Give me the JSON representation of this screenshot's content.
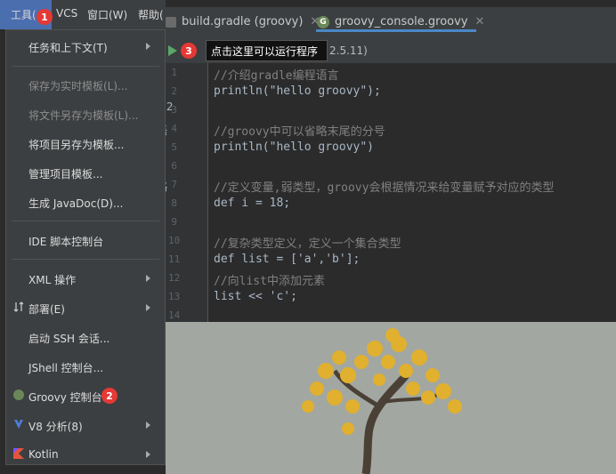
{
  "menubar": {
    "items": [
      {
        "label": "工具(",
        "selected": true
      },
      {
        "label": "VCS"
      },
      {
        "label": "窗口(W)"
      },
      {
        "label": "帮助("
      }
    ]
  },
  "tabs": [
    {
      "label": "build.gradle (groovy)",
      "icon": "gradle-icon"
    },
    {
      "label": "groovy_console.groovy",
      "icon": "groovy-icon",
      "active": true
    }
  ],
  "toolbar": {
    "tooltip": "点击这里可以运行程序",
    "version": "2.5.11)"
  },
  "editor": {
    "line_numbers": [
      "1",
      "2",
      "3",
      "4",
      "5",
      "6",
      "7",
      "8",
      "9",
      "10",
      "11",
      "12",
      "13",
      "14"
    ],
    "lines": [
      "//介绍gradle编程语言",
      "println(\"hello groovy\");",
      "",
      "//groovy中可以省略末尾的分号",
      "println(\"hello groovy\")",
      "",
      "//定义变量,弱类型，groovy会根据情况来给变量赋予对应的类型",
      "def i = 18;",
      "",
      "//复杂类型定义，定义一个集合类型",
      "def list = ['a','b'];",
      "//向list中添加元素",
      "list << 'c';"
    ]
  },
  "peek": [
    "g",
    "y 2",
    "语",
    "g",
    "略",
    "g",
    "，",
    "义",
    "，",
    "素"
  ],
  "dropdown": {
    "items": [
      {
        "label": "任务和上下文(T)",
        "submenu": true,
        "enabled": true
      },
      {
        "label": "保存为实时模板(L)...",
        "enabled": false
      },
      {
        "label": "将文件另存为模板(L)...",
        "enabled": false
      },
      {
        "label": "将项目另存为模板...",
        "enabled": true
      },
      {
        "label": "管理项目模板...",
        "enabled": true
      },
      {
        "label": "生成 JavaDoc(D)...",
        "enabled": true
      },
      {
        "label": "IDE 脚本控制台",
        "enabled": true
      },
      {
        "label": "XML 操作",
        "submenu": true,
        "enabled": true
      },
      {
        "label": "部署(E)",
        "submenu": true,
        "enabled": true,
        "icon": "deploy-icon"
      },
      {
        "label": "启动 SSH 会话...",
        "enabled": true
      },
      {
        "label": "JShell 控制台...",
        "enabled": true
      },
      {
        "label": "Groovy 控制台...",
        "enabled": true,
        "icon": "groovy-icon"
      },
      {
        "label": "V8 分析(8)",
        "submenu": true,
        "enabled": true,
        "icon": "v8-icon"
      },
      {
        "label": "Kotlin",
        "submenu": true,
        "enabled": true,
        "icon": "kotlin-icon"
      }
    ]
  },
  "badges": [
    "1",
    "2",
    "3"
  ],
  "colors": {
    "accent": "#4a88c7",
    "badge": "#e53935",
    "run": "#59a869"
  }
}
